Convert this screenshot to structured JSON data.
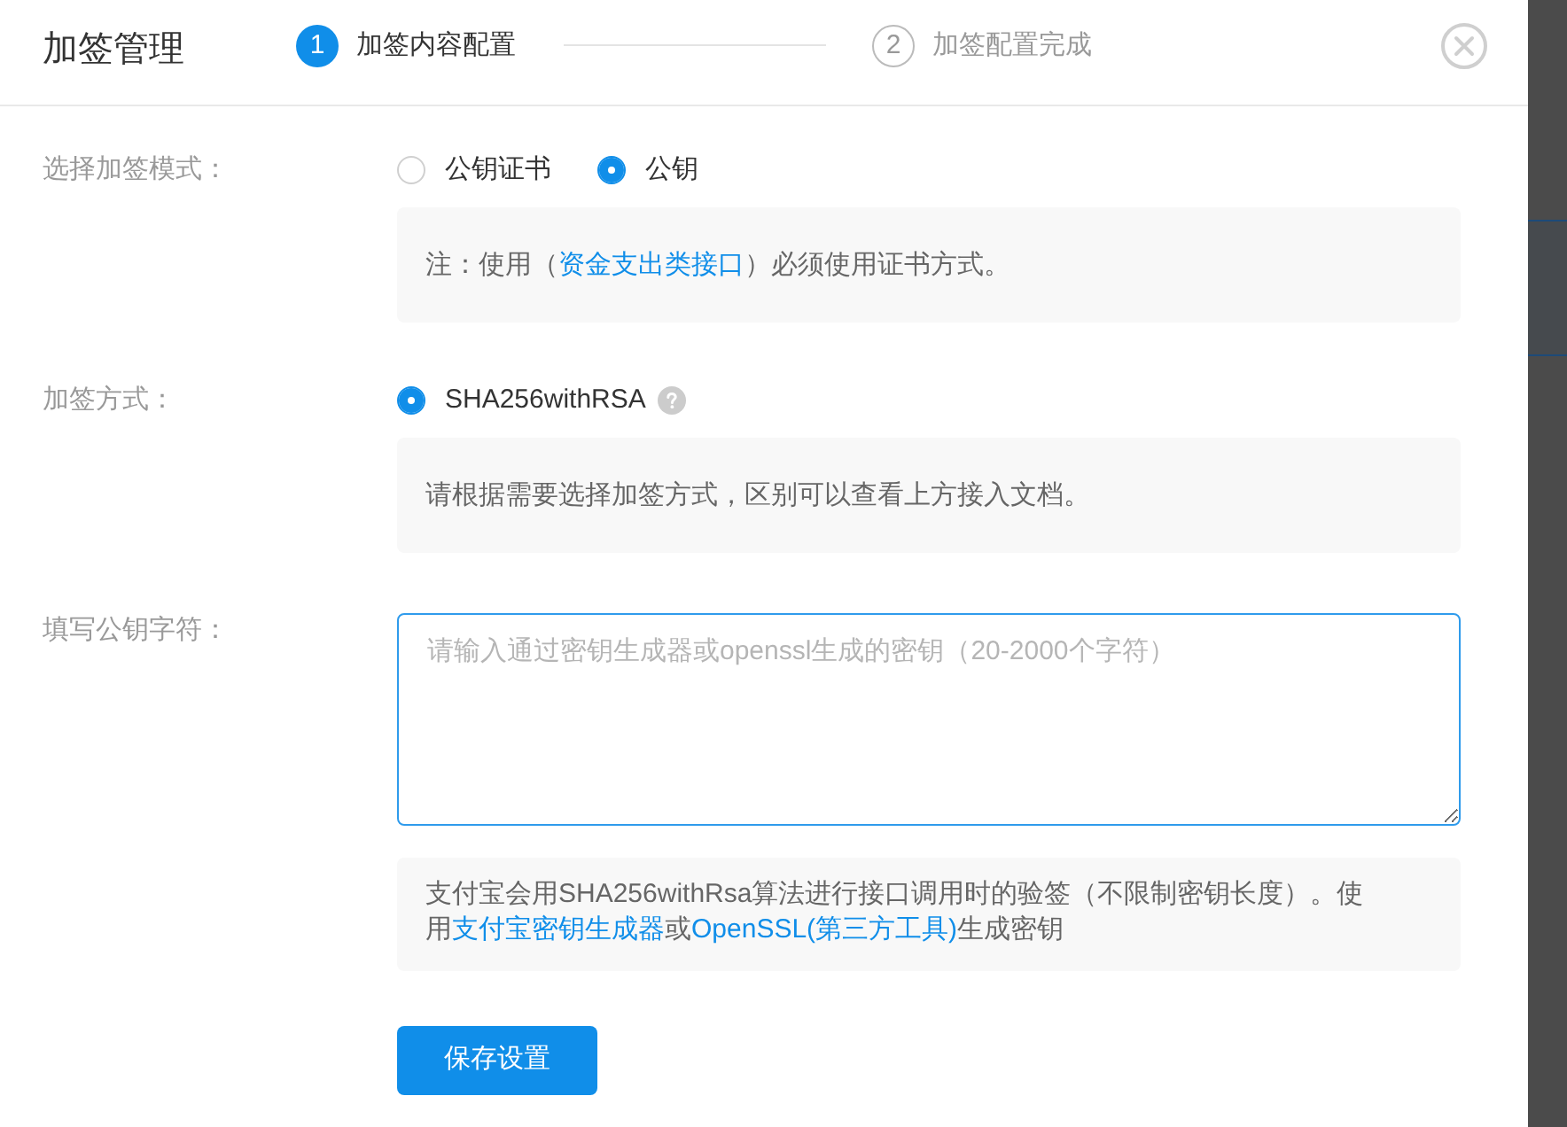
{
  "dialog": {
    "title": "加签管理"
  },
  "steps": [
    {
      "number": "1",
      "label": "加签内容配置",
      "selected": true
    },
    {
      "number": "2",
      "label": "加签配置完成",
      "selected": false
    }
  ],
  "form": {
    "rows": [
      {
        "kind": "radio",
        "label": "选择加签模式：",
        "options": [
          {
            "label": "公钥证书",
            "selected": false
          },
          {
            "label": "公钥",
            "selected": true
          }
        ],
        "note": [
          {
            "kind": "text",
            "text": "注：使用（"
          },
          {
            "kind": "link",
            "text": "资金支出类接口"
          },
          {
            "kind": "text",
            "text": "）必须使用证书方式。"
          }
        ]
      },
      {
        "kind": "radio",
        "label": "加签方式：",
        "options": [
          {
            "label": "SHA256withRSA",
            "selected": true,
            "help": true
          }
        ],
        "note": [
          {
            "kind": "text",
            "text": "请根据需要选择加签方式，区别可以查看上方接入文档。"
          }
        ]
      },
      {
        "kind": "textarea",
        "label": "填写公钥字符：",
        "placeholder": "请输入通过密钥生成器或openssl生成的密钥（20-2000个字符）",
        "focused": true,
        "note": [
          {
            "kind": "text",
            "text": "支付宝会用SHA256withRsa算法进行接口调用时的验签（不限制密钥长度）。使用"
          },
          {
            "kind": "link",
            "text": "支付宝密钥生成器"
          },
          {
            "kind": "text",
            "text": "或"
          },
          {
            "kind": "link",
            "text": "OpenSSL(第三方工具)"
          },
          {
            "kind": "text",
            "text": "生成密钥"
          }
        ]
      }
    ]
  },
  "save_button": {
    "label": "保存设置"
  }
}
